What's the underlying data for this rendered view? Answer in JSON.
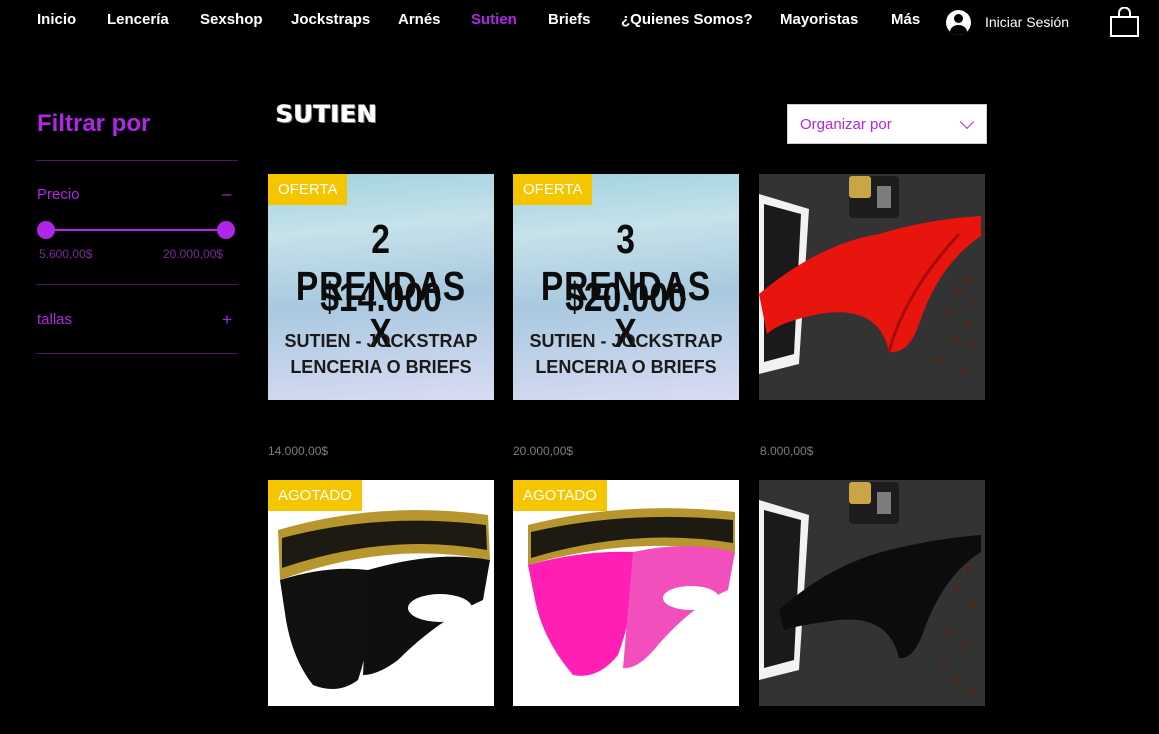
{
  "nav": {
    "items": [
      {
        "label": "Inicio",
        "active": false
      },
      {
        "label": "Lencería",
        "active": false
      },
      {
        "label": "Sexshop",
        "active": false
      },
      {
        "label": "Jockstraps",
        "active": false
      },
      {
        "label": "Arnés",
        "active": false
      },
      {
        "label": "Sutien",
        "active": true
      },
      {
        "label": "Briefs",
        "active": false
      },
      {
        "label": "¿Quienes Somos?",
        "active": false
      },
      {
        "label": "Mayoristas",
        "active": false
      },
      {
        "label": "Más",
        "active": false
      }
    ],
    "login_label": "Iniciar Sesión",
    "login_icon": "user-avatar-icon",
    "cart_icon": "shopping-bag-icon"
  },
  "sidebar": {
    "title": "Filtrar por",
    "price": {
      "label": "Precio",
      "toggle": "–",
      "min": "5.600,00$",
      "max": "20.000,00$"
    },
    "sizes": {
      "label": "tallas",
      "toggle": "+"
    }
  },
  "main": {
    "heading": "SUTIEN",
    "sort": {
      "placeholder": "Organizar por",
      "icon": "chevron-down-icon"
    },
    "products": [
      {
        "badge": "OFERTA",
        "price": "14.000,00$",
        "promo": {
          "line1": "2 PRENDAS X",
          "line2": "$14.000",
          "line3": "SUTIEN - JOCKSTRAP",
          "line4": "LENCERIA O BRIEFS"
        }
      },
      {
        "badge": "OFERTA",
        "price": "20.000,00$",
        "promo": {
          "line1": "3 PRENDAS X",
          "line2": "$20.000",
          "line3": "SUTIEN - JOCKSTRAP",
          "line4": "LENCERIA O BRIEFS"
        }
      },
      {
        "badge": "",
        "price": "8.000,00$"
      },
      {
        "badge": "AGOTADO"
      },
      {
        "badge": "AGOTADO"
      },
      {
        "badge": ""
      }
    ]
  },
  "colors": {
    "accent": "#b025e6",
    "badge": "#f5c500",
    "background": "#000000"
  }
}
